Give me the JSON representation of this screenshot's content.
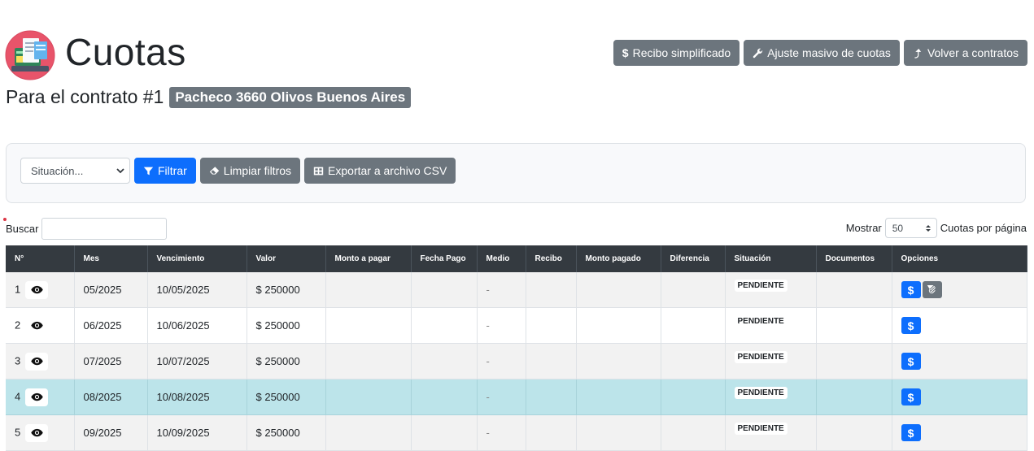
{
  "header": {
    "title": "Cuotas",
    "buttons": {
      "recibo": "Recibo simplificado",
      "ajuste": "Ajuste masivo de cuotas",
      "volver": "Volver a contratos"
    }
  },
  "contract": {
    "label": "Para el contrato #1",
    "address": "Pacheco 3660 Olivos Buenos Aires"
  },
  "filters": {
    "situacion_placeholder": "Situación...",
    "filtrar": "Filtrar",
    "limpiar": "Limpiar filtros",
    "exportar": "Exportar a archivo CSV"
  },
  "search": {
    "label": "Buscar"
  },
  "pagination": {
    "mostrar": "Mostrar",
    "value": "50",
    "suffix": "Cuotas por página"
  },
  "table": {
    "columns": [
      "N°",
      "Mes",
      "Vencimiento",
      "Valor",
      "Monto a pagar",
      "Fecha Pago",
      "Medio",
      "Recibo",
      "Monto pagado",
      "Diferencia",
      "Situación",
      "Documentos",
      "Opciones"
    ],
    "rows": [
      {
        "n": "1",
        "mes": "05/2025",
        "vencimiento": "10/05/2025",
        "valor": "$ 250000",
        "medio": "-",
        "situacion": "PENDIENTE"
      },
      {
        "n": "2",
        "mes": "06/2025",
        "vencimiento": "10/06/2025",
        "valor": "$ 250000",
        "medio": "-",
        "situacion": "PENDIENTE"
      },
      {
        "n": "3",
        "mes": "07/2025",
        "vencimiento": "10/07/2025",
        "valor": "$ 250000",
        "medio": "-",
        "situacion": "PENDIENTE"
      },
      {
        "n": "4",
        "mes": "08/2025",
        "vencimiento": "10/08/2025",
        "valor": "$ 250000",
        "medio": "-",
        "situacion": "PENDIENTE"
      },
      {
        "n": "5",
        "mes": "09/2025",
        "vencimiento": "10/09/2025",
        "valor": "$ 250000",
        "medio": "-",
        "situacion": "PENDIENTE"
      }
    ],
    "pay_icon": "$"
  },
  "colors": {
    "primary": "#0d6efd",
    "secondary": "#6c757d",
    "dark_header": "#343a40",
    "highlight_row": "#bce4ea"
  },
  "icons": {
    "logo": "payments-logo",
    "eye": "eye-icon",
    "attach": "paperclip-icon",
    "filter": "filter-icon",
    "eraser": "eraser-icon",
    "table": "table-icon",
    "dollar": "dollar-icon",
    "wrench": "wrench-icon",
    "return": "return-arrow-icon"
  }
}
